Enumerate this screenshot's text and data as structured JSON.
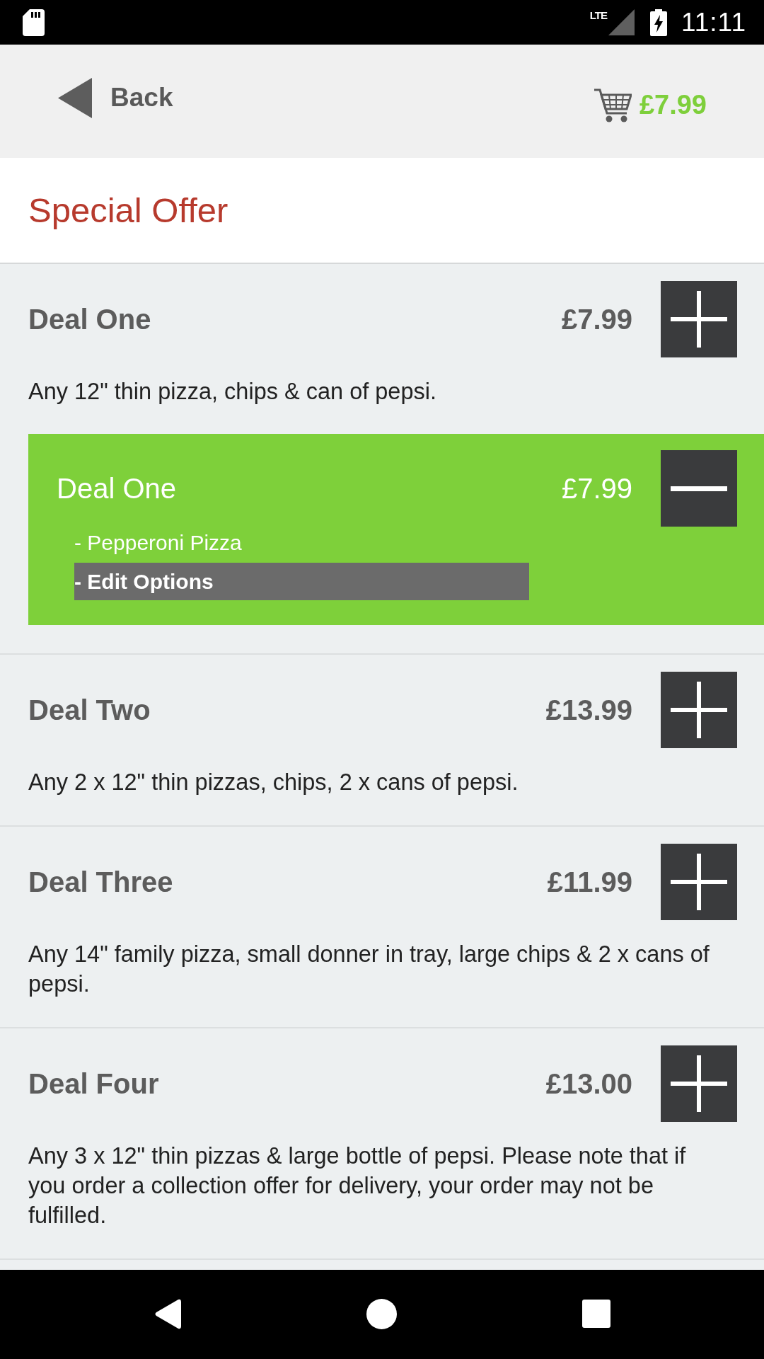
{
  "status_bar": {
    "network": "LTE",
    "time": "11:11"
  },
  "header": {
    "back_label": "Back",
    "cart_total": "£7.99"
  },
  "page_title": "Special Offer",
  "deals": [
    {
      "title": "Deal One",
      "price": "£7.99",
      "description": "Any 12\" thin pizza, chips & can of pepsi.",
      "cart_items": [
        {
          "title": "Deal One",
          "price": "£7.99",
          "options": [
            "- Pepperoni Pizza"
          ],
          "edit_label": "- Edit Options"
        }
      ]
    },
    {
      "title": "Deal Two",
      "price": "£13.99",
      "description": "Any 2 x 12\" thin pizzas, chips, 2 x cans of pepsi."
    },
    {
      "title": "Deal Three",
      "price": "£11.99",
      "description": "Any 14\" family pizza, small donner in tray, large chips & 2 x cans of pepsi."
    },
    {
      "title": "Deal Four",
      "price": "£13.00",
      "description": "Any 3 x 12\" thin pizzas & large bottle of pepsi. Please note that if you order a collection offer for delivery, your order may not be fulfilled."
    }
  ]
}
